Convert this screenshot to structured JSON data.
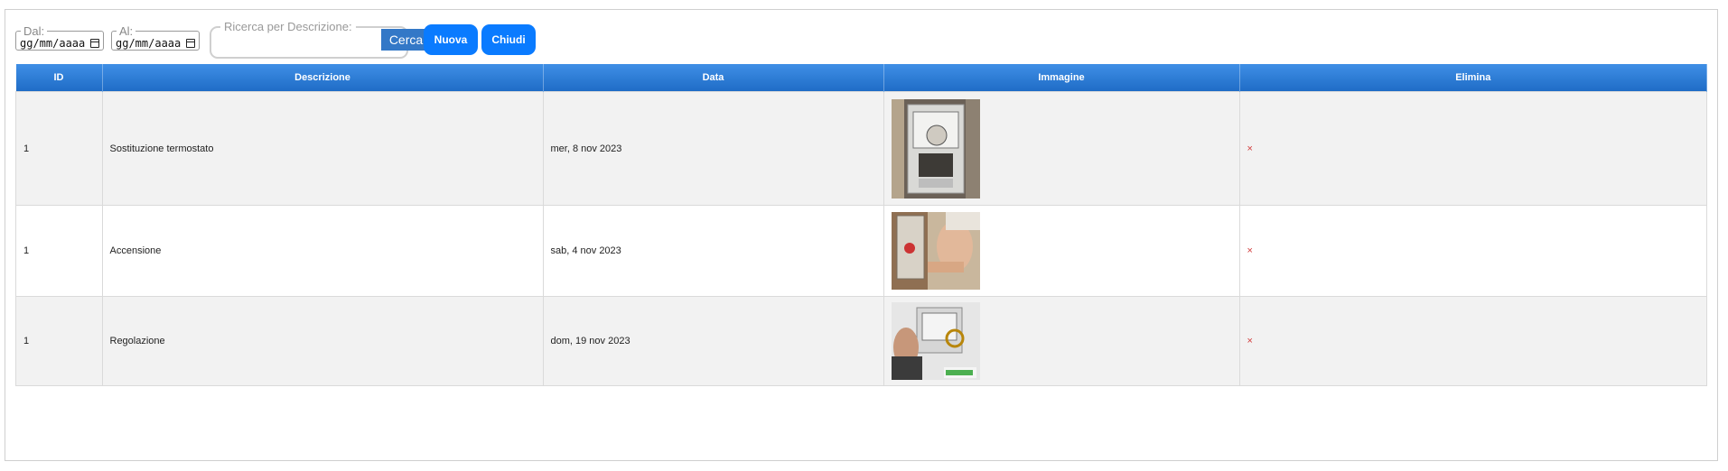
{
  "filters": {
    "from_label": "Dal:",
    "from_value": "gg/mm/aaaa",
    "to_label": "Al:",
    "to_value": "gg/mm/aaaa",
    "search_label": "Ricerca per Descrizione:",
    "search_value": ""
  },
  "buttons": {
    "search": "Cerca",
    "new": "Nuova",
    "close": "Chiudi"
  },
  "table": {
    "headers": [
      "ID",
      "Descrizione",
      "Data",
      "Immagine",
      "Elimina"
    ],
    "rows": [
      {
        "id": "1",
        "description": "Sostituzione termostato",
        "date": "mer, 8 nov 2023",
        "delete": "×"
      },
      {
        "id": "1",
        "description": "Accensione",
        "date": "sab, 4 nov 2023",
        "delete": "×"
      },
      {
        "id": "1",
        "description": "Regolazione",
        "date": "dom, 19 nov 2023",
        "delete": "×"
      }
    ]
  },
  "colors": {
    "header": "#2a7bd4",
    "button_primary": "#0a7bff",
    "button_search": "#3378c7",
    "delete": "#d23b3b"
  },
  "icons": [
    "calendar-icon",
    "delete-icon"
  ]
}
